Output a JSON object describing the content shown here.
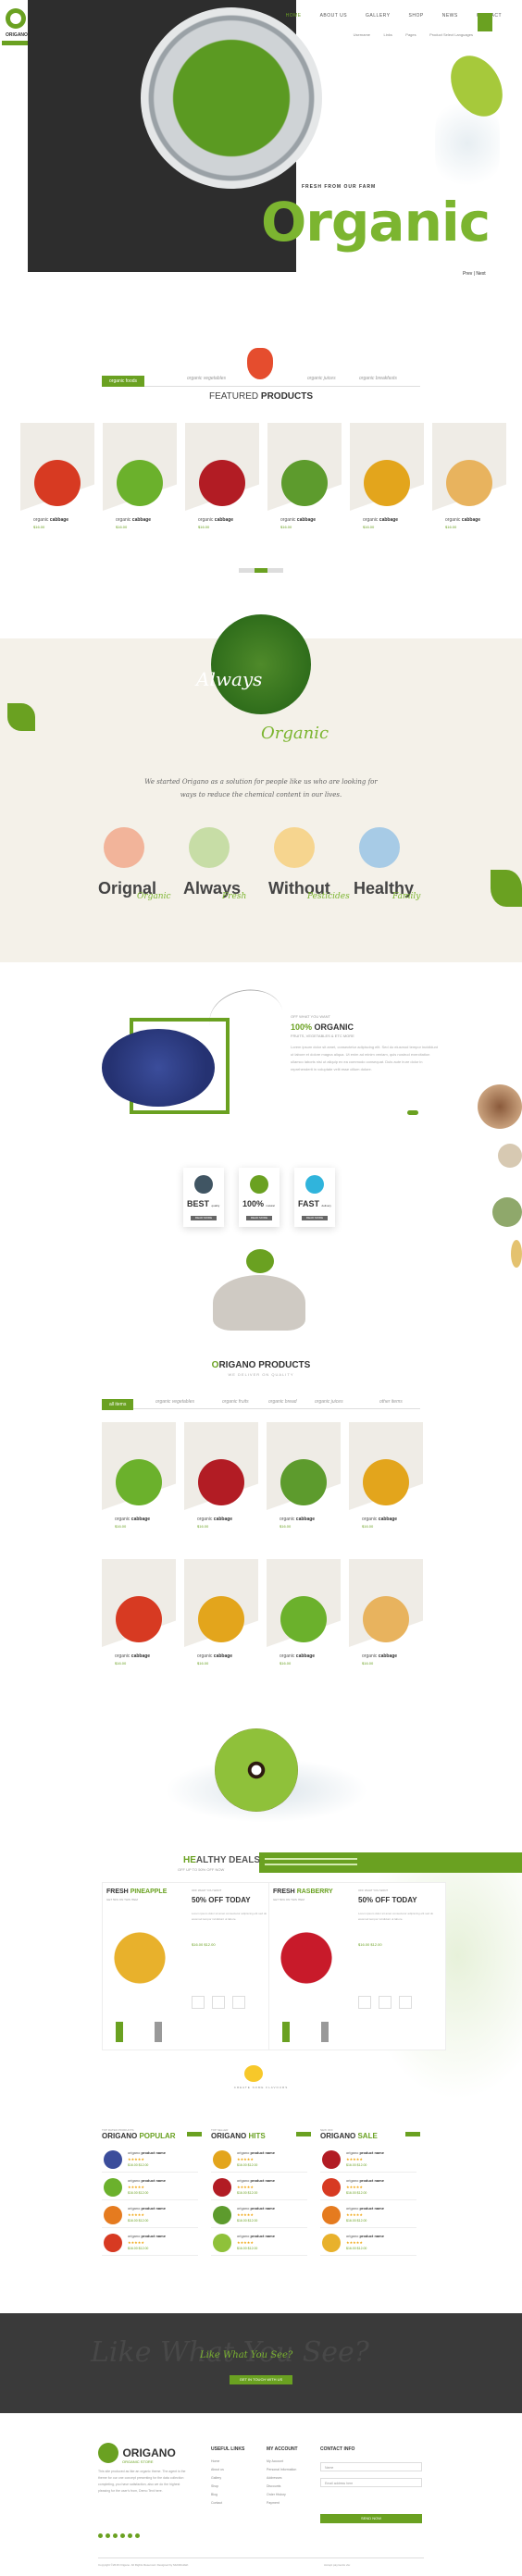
{
  "header": {
    "nav": [
      "HOME",
      "ABOUT US",
      "GALLERY",
      "SHOP",
      "NEWS",
      "CONTACT"
    ],
    "subnav": [
      "Username",
      "Links",
      "Pages",
      "Product Select Languages"
    ],
    "logo": {
      "name": "ORIGANO"
    },
    "hero_small": "FRESH FROM OUR FARM",
    "hero_big": "Organic",
    "pager": "Prev  |  Next"
  },
  "featured": {
    "tabs": [
      "organic foods",
      "organic vegetables",
      "organic juices",
      "organic breakfasts"
    ],
    "title_light": "FEATURED",
    "title_bold": "PRODUCTS",
    "cards": [
      {
        "name_light": "organic",
        "name_bold": "cabbage",
        "price": "$16.00",
        "veg_color": "#d73a22"
      },
      {
        "name_light": "organic",
        "name_bold": "cabbage",
        "price": "$16.00",
        "veg_color": "#6bb12c"
      },
      {
        "name_light": "organic",
        "name_bold": "cabbage",
        "price": "$16.00",
        "veg_color": "#b21c24"
      },
      {
        "name_light": "organic",
        "name_bold": "cabbage",
        "price": "$16.00",
        "veg_color": "#5d9b2d"
      },
      {
        "name_light": "organic",
        "name_bold": "cabbage",
        "price": "$16.00",
        "veg_color": "#e3a51c"
      },
      {
        "name_light": "organic",
        "name_bold": "cabbage",
        "price": "$16.00",
        "veg_color": "#e8b35e"
      }
    ]
  },
  "about": {
    "always": "Always",
    "organic": "Organic",
    "story": "We started Origano as a solution for people like us who are looking for ways to reduce the chemical content in our lives.",
    "features": [
      {
        "big": "Orignal",
        "script": "Organic",
        "color": "#f2b49a"
      },
      {
        "big": "Always",
        "script": "Fresh",
        "color": "#c7dda6"
      },
      {
        "big": "Without",
        "script": "Pesticides",
        "color": "#f6d58f"
      },
      {
        "big": "Healthy",
        "script": "Family",
        "color": "#a7cbe6"
      }
    ]
  },
  "organic_info": {
    "small": "OFF WHAT YOU WANT",
    "title_bold": "100%",
    "title_rest": "ORGANIC",
    "sub": "FRUITS, VEGETABLES & ETC MORE",
    "text": "Lorem ipsum dolor sit amet, consectetur adipiscing elit. Sed do eiusmod tempor incididunt ut labore et dolore magna aliqua. Ut enim ad minim veniam, quis nostrud exercitation ullamco laboris nisi ut aliquip ex ea commodo consequat. Duis aute irure dolor in reprehenderit in voluptate velit esse cillum dolore."
  },
  "badges": [
    {
      "big": "BEST",
      "small": "quality",
      "btn": "READ MORE",
      "color": "#405563"
    },
    {
      "big": "100%",
      "small": "natural",
      "btn": "READ MORE",
      "color": "#6aa121"
    },
    {
      "big": "FAST",
      "small": "delivery",
      "btn": "READ MORE",
      "color": "#30b4dc"
    }
  ],
  "products": {
    "title_o": "O",
    "title_rest": "RIGANO",
    "title_bold": "PRODUCTS",
    "sub": "WE DELIVER ON QUALITY",
    "tabs": [
      "all items",
      "organic vegetables",
      "organic fruits",
      "organic bread",
      "organic juices",
      "other items"
    ],
    "cards": [
      {
        "name_light": "organic",
        "name_bold": "cabbage",
        "price": "$16.00",
        "veg_color": "#6bb12c"
      },
      {
        "name_light": "organic",
        "name_bold": "cabbage",
        "price": "$16.00",
        "veg_color": "#b21c24"
      },
      {
        "name_light": "organic",
        "name_bold": "cabbage",
        "price": "$16.00",
        "veg_color": "#5d9b2d"
      },
      {
        "name_light": "organic",
        "name_bold": "cabbage",
        "price": "$16.00",
        "veg_color": "#e3a51c"
      },
      {
        "name_light": "organic",
        "name_bold": "cabbage",
        "price": "$16.00",
        "veg_color": "#d73a22"
      },
      {
        "name_light": "organic",
        "name_bold": "cabbage",
        "price": "$16.00",
        "veg_color": "#e3a51c"
      },
      {
        "name_light": "organic",
        "name_bold": "cabbage",
        "price": "$16.00",
        "veg_color": "#6bb12c"
      },
      {
        "name_light": "organic",
        "name_bold": "cabbage",
        "price": "$16.00",
        "veg_color": "#e8b35e"
      }
    ]
  },
  "deals": {
    "title_a": "HE",
    "title_b": "ALTHY",
    "title_c": "DEALS",
    "sub": "OFF UP TO 50% OFF NOW",
    "cards": [
      {
        "name": "FRESH",
        "name_b": "PINEAPPLE",
        "small": "GET 50% ON THIS ITEM",
        "mh": "OFF WHAT YOU WANT",
        "off": "50% OFF TODAY",
        "price": "$16.00  $12.00",
        "color": "#e8b12c"
      },
      {
        "name": "FRESH",
        "name_b": "RASBERRY",
        "small": "GET 50% ON THIS ITEM",
        "mh": "OFF WHAT YOU WANT",
        "off": "50% OFF TODAY",
        "price": "$16.00  $12.00",
        "color": "#c81a2a"
      }
    ],
    "deal_text": "Lorem ipsum dolor sit amet consectetur adipiscing elit sed do eiusmod tempor incididunt ut labore."
  },
  "lemon": {
    "text": "CREATE SOME FLAVOURS"
  },
  "lists": [
    {
      "small": "TOP RATED PRODUCTS",
      "title": "ORIGANO",
      "title_b": "POPULAR",
      "items": [
        {
          "n": "origano",
          "b": "product name",
          "st": "★★★★★",
          "p": "$16.00  $12.00",
          "c": "#3b4d9b"
        },
        {
          "n": "origano",
          "b": "product name",
          "st": "★★★★★",
          "p": "$16.00  $12.00",
          "c": "#6bb12c"
        },
        {
          "n": "origano",
          "b": "product name",
          "st": "★★★★★",
          "p": "$16.00  $12.00",
          "c": "#e57b1f"
        },
        {
          "n": "origano",
          "b": "product name",
          "st": "★★★★★",
          "p": "$16.00  $12.00",
          "c": "#d73a22"
        }
      ]
    },
    {
      "small": "TOP SELLER",
      "title": "ORIGANO",
      "title_b": "HITS",
      "items": [
        {
          "n": "origano",
          "b": "product name",
          "st": "★★★★★",
          "p": "$16.00  $12.00",
          "c": "#e3a51c"
        },
        {
          "n": "origano",
          "b": "product name",
          "st": "★★★★★",
          "p": "$16.00  $12.00",
          "c": "#b21c24"
        },
        {
          "n": "origano",
          "b": "product name",
          "st": "★★★★★",
          "p": "$16.00  $12.00",
          "c": "#5d9b2d"
        },
        {
          "n": "origano",
          "b": "product name",
          "st": "★★★★★",
          "p": "$16.00  $12.00",
          "c": "#8fc13a"
        }
      ]
    },
    {
      "small": "NEW OFF",
      "title": "ORIGANO",
      "title_b": "SALE",
      "items": [
        {
          "n": "origano",
          "b": "product name",
          "st": "★★★★★",
          "p": "$16.00  $12.00",
          "c": "#b21c24"
        },
        {
          "n": "origano",
          "b": "product name",
          "st": "★★★★★",
          "p": "$16.00  $12.00",
          "c": "#d73a22"
        },
        {
          "n": "origano",
          "b": "product name",
          "st": "★★★★★",
          "p": "$16.00  $12.00",
          "c": "#e57b1f"
        },
        {
          "n": "origano",
          "b": "product name",
          "st": "★★★★★",
          "p": "$16.00  $12.00",
          "c": "#e8b12c"
        }
      ]
    }
  ],
  "banner": {
    "bg": "Like What You See?",
    "script": "Like What You See?",
    "btn": "GET IN TOUCH WITH US"
  },
  "footer": {
    "logo": "ORIGANO",
    "logo_sub": "ORGANIC STORE",
    "text": "This site produced as like an organic theme. The agent is the theme for our one concept presenting for the data collection completing, you have satisfaction, also we do the highest pleasing for the user's from, Demo Text here.",
    "cols": [
      {
        "h": "USEFUL LINKS",
        "links": [
          "Home",
          "About us",
          "Gallery",
          "Shop",
          "Blog",
          "Contact"
        ]
      },
      {
        "h": "MY ACCOUNT",
        "links": [
          "My Account",
          "Personal Information",
          "Addresses",
          "Discounts",
          "Order History",
          "Payment"
        ]
      }
    ],
    "contact_h": "CONTACT INFO",
    "name_ph": "Name",
    "email_ph": "Email address here",
    "submit": "SEND NOW",
    "copyright": "Copyright ©2016 Origano. All Rights Reserved. Designed by Muhibbullah",
    "payments": "Accept payments via:"
  }
}
